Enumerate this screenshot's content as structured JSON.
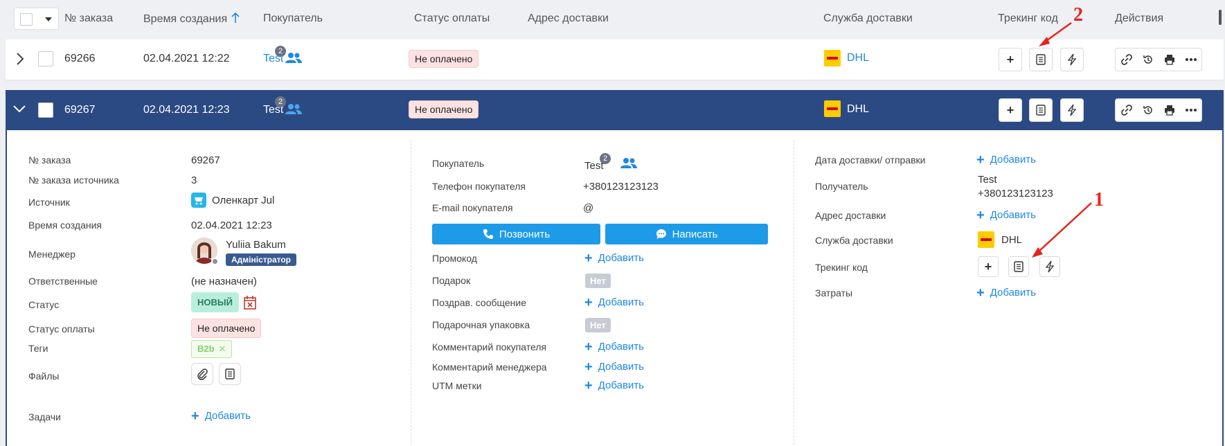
{
  "header": {
    "columns": [
      "№ заказа",
      "Время создания",
      "Покупатель",
      "Статус оплаты",
      "Адрес доставки",
      "Служба доставки",
      "Трекинг код",
      "Действия"
    ],
    "sort_icon": "arrow-up-icon"
  },
  "orders": [
    {
      "id": "69266",
      "created": "02.04.2021 12:22",
      "buyer": "Test",
      "buyer_count": "2",
      "payment_status": "Не оплачено",
      "delivery": "DHL"
    },
    {
      "id": "69267",
      "created": "02.04.2021 12:23",
      "buyer": "Test",
      "buyer_count": "2",
      "payment_status": "Не оплачено",
      "delivery": "DHL"
    }
  ],
  "detail": {
    "left": {
      "order_no_label": "№ заказа",
      "order_no": "69267",
      "source_no_label": "№ заказа источника",
      "source_no": "3",
      "source_label": "Источник",
      "source": "Оленкарт Jul",
      "created_label": "Время создания",
      "created": "02.04.2021 12:23",
      "manager_label": "Менеджер",
      "manager_name": "Yuliia Bakum",
      "manager_role": "Адміністратор",
      "responsible_label": "Ответственные",
      "responsible": "(не назначен)",
      "status_label": "Статус",
      "status": "НОВЫЙ",
      "pay_status_label": "Статус оплаты",
      "pay_status": "Не оплачено",
      "tags_label": "Теги",
      "tag": "B2b",
      "files_label": "Файлы",
      "tasks_label": "Задачи",
      "tasks_add": "Добавить"
    },
    "middle": {
      "buyer_label": "Покупатель",
      "buyer": "Test",
      "buyer_count": "2",
      "phone_label": "Телефон покупателя",
      "phone": "+380123123123",
      "email_label": "E-mail покупателя",
      "email": "@",
      "call_btn": "Позвонить",
      "write_btn": "Написать",
      "promo_label": "Промокод",
      "promo_add": "Добавить",
      "gift_label": "Подарок",
      "gift": "Нет",
      "greeting_label": "Поздрав. сообщение",
      "greeting_add": "Добавить",
      "wrap_label": "Подарочная упаковка",
      "wrap": "Нет",
      "buyer_comment_label": "Комментарий покупателя",
      "buyer_comment_add": "Добавить",
      "manager_comment_label": "Комментарий менеджера",
      "manager_comment_add": "Добавить",
      "utm_label": "UTM метки",
      "utm_add": "Добавить"
    },
    "right": {
      "delivery_date_label": "Дата доставки/ отправки",
      "delivery_date_add": "Добавить",
      "recipient_label": "Получатель",
      "recipient_name": "Test",
      "recipient_phone": "+380123123123",
      "address_label": "Адрес доставки",
      "address_add": "Добавить",
      "service_label": "Служба доставки",
      "service": "DHL",
      "tracking_label": "Трекинг код",
      "costs_label": "Затраты",
      "costs_add": "Добавить"
    }
  },
  "annotations": {
    "marker1": "1",
    "marker2": "2",
    "color": "#e8231f"
  },
  "colors": {
    "accent": "#1e88e5",
    "row_selected": "#2b4a83",
    "badge_red_bg": "#fde2e2",
    "status_new_bg": "#b9eedd"
  }
}
